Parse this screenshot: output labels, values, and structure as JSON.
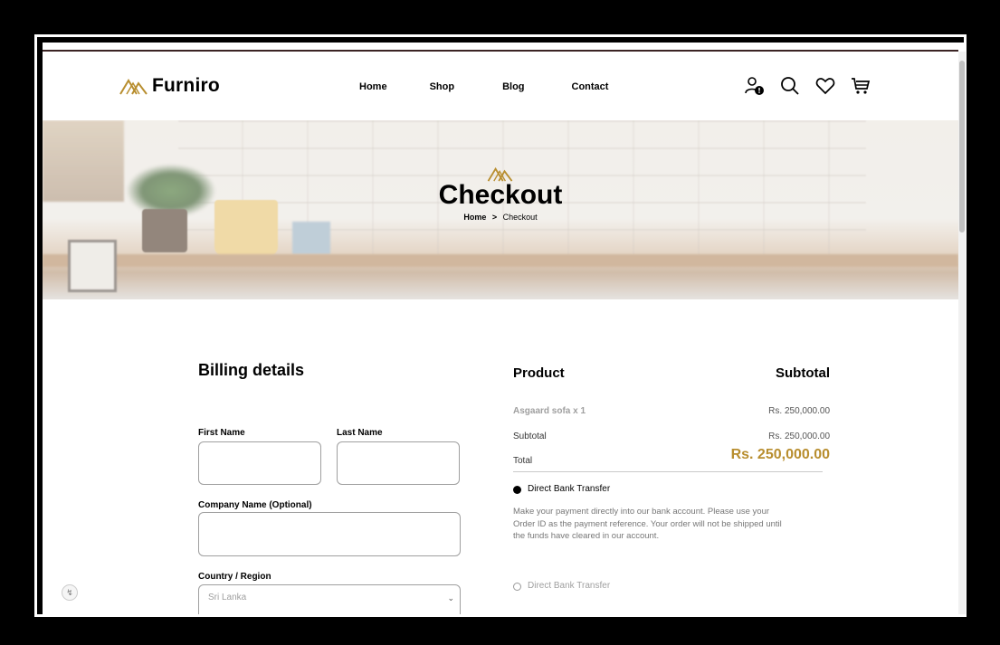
{
  "brand": {
    "name": "Furniro",
    "accent": "#B88E2F",
    "mark_icon": "furniro-logo-icon"
  },
  "nav": {
    "items": [
      "Home",
      "Shop",
      "Blog",
      "Contact"
    ]
  },
  "header_icons": [
    "user-alert-icon",
    "search-icon",
    "heart-icon",
    "cart-icon"
  ],
  "banner": {
    "title": "Checkout",
    "breadcrumb": {
      "home": "Home",
      "separator": ">",
      "current": "Checkout"
    }
  },
  "billing": {
    "title": "Billing details",
    "first_name_label": "First Name",
    "last_name_label": "Last Name",
    "company_label": "Company Name (Optional)",
    "country_label": "Country / Region",
    "country_value": "Sri Lanka"
  },
  "order": {
    "product_header": "Product",
    "subtotal_header": "Subtotal",
    "item_label": "Asgaard sofa x 1",
    "item_price": "Rs. 250,000.00",
    "subtotal_label": "Subtotal",
    "subtotal_value": "Rs. 250,000.00",
    "total_label": "Total",
    "total_value": "Rs. 250,000.00"
  },
  "payment": {
    "option1_label": "Direct Bank Transfer",
    "option1_selected": true,
    "description": "Make your payment directly into our bank account. Please use your Order ID as the payment reference. Your order will not be shipped until the funds have cleared in our account.",
    "option2_label": "Direct Bank Transfer",
    "option2_selected": false
  }
}
